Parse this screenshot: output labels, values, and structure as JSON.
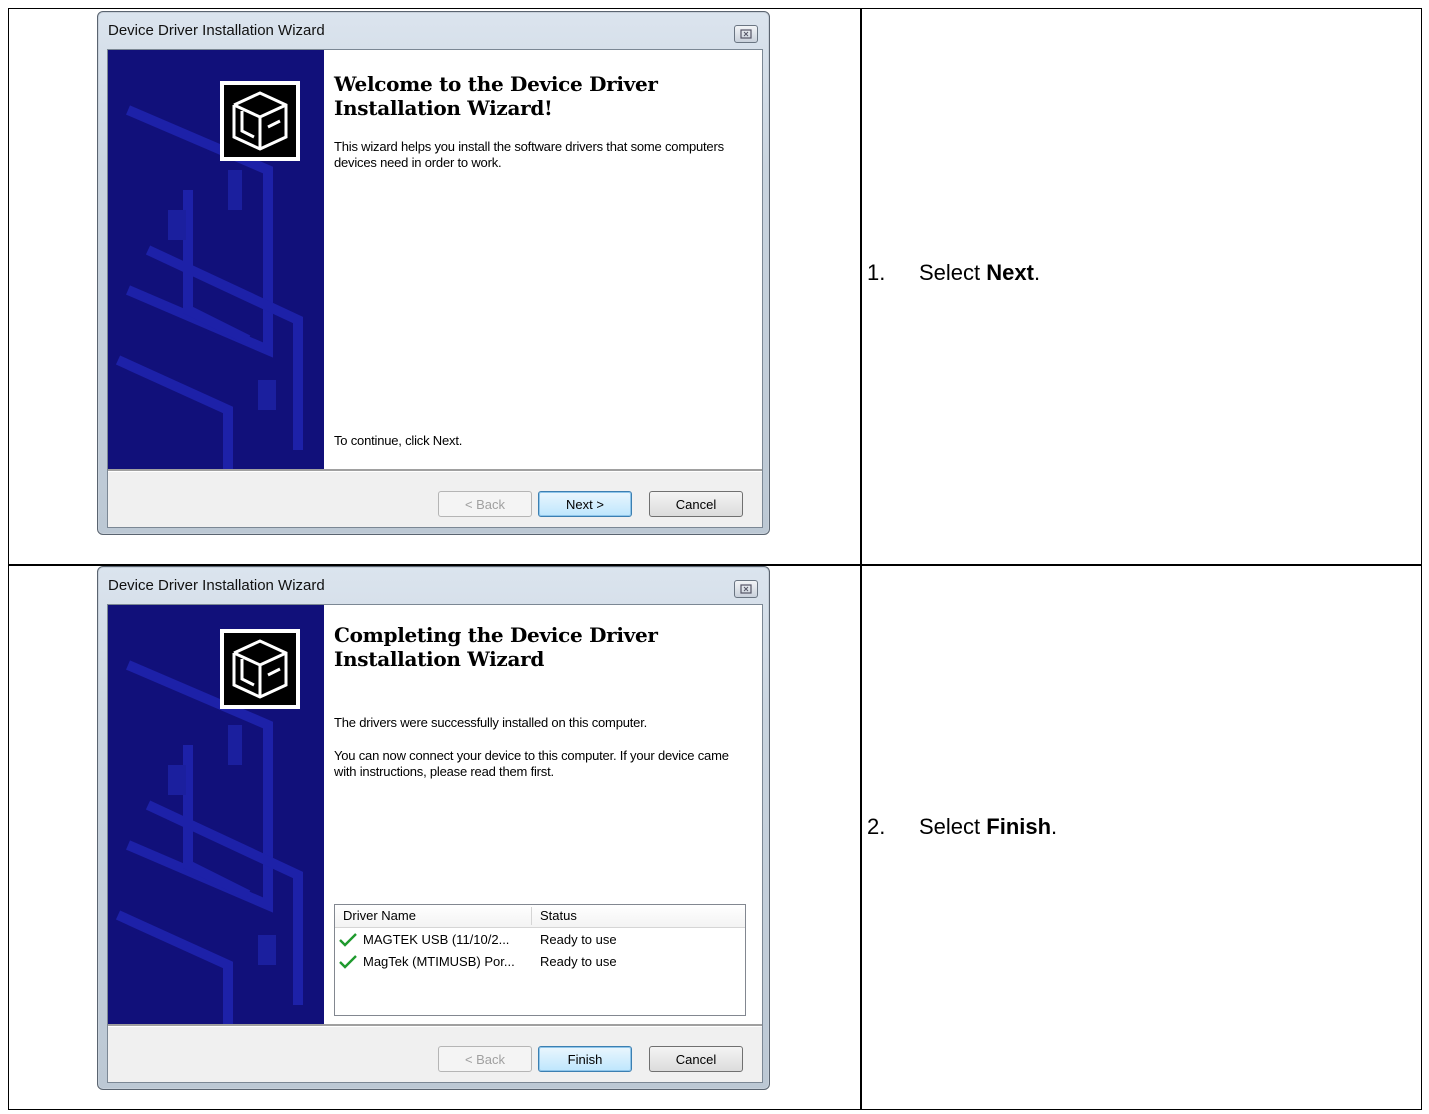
{
  "steps": [
    {
      "number": "1.",
      "prefix": "Select ",
      "bold": "Next",
      "suffix": "."
    },
    {
      "number": "2.",
      "prefix": "Select ",
      "bold": "Finish",
      "suffix": "."
    }
  ],
  "wizards": [
    {
      "title": "Device Driver Installation Wizard",
      "heading": "Welcome to the Device Driver Installation Wizard!",
      "intro": "This wizard helps you install the software drivers that some computers devices need in order to work.",
      "footer_text": "To continue, click Next.",
      "buttons": {
        "back": "< Back",
        "next": "Next >",
        "cancel": "Cancel"
      }
    },
    {
      "title": "Device Driver Installation Wizard",
      "heading": "Completing the Device Driver Installation Wizard",
      "text1": "The drivers were successfully installed on this computer.",
      "text2": "You can now connect your device to this computer. If your device came with instructions, please read them first.",
      "list": {
        "headers": [
          "Driver Name",
          "Status"
        ],
        "rows": [
          {
            "name": "MAGTEK USB  (11/10/2...",
            "status": "Ready to use"
          },
          {
            "name": "MagTek (MTIMUSB) Por...",
            "status": "Ready to use"
          }
        ]
      },
      "buttons": {
        "back": "< Back",
        "finish": "Finish",
        "cancel": "Cancel"
      }
    }
  ],
  "colors": {
    "sidebar": "#11107a",
    "check": "#1f9a2e"
  }
}
